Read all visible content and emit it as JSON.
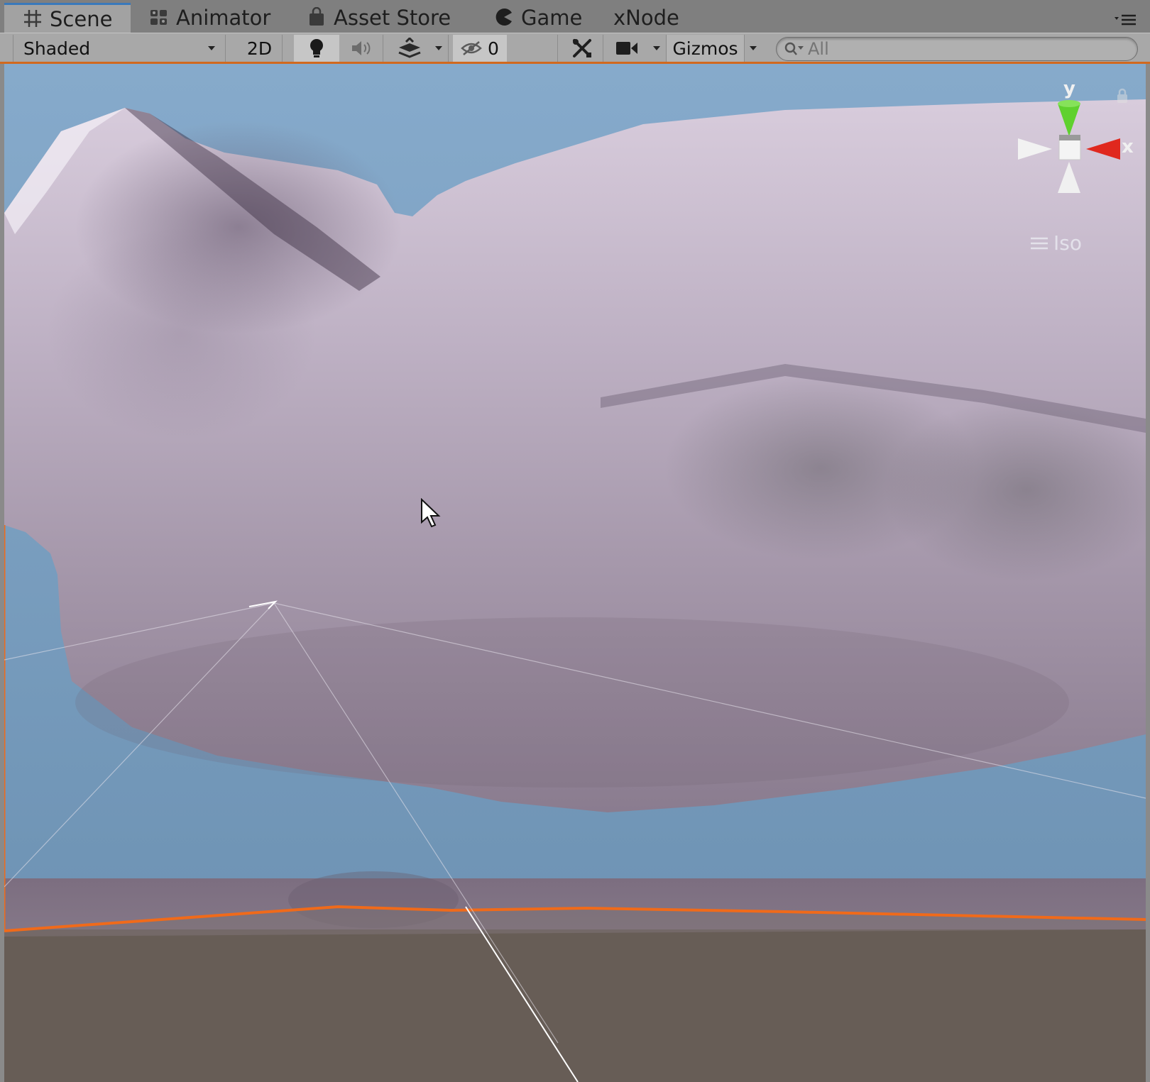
{
  "tabs": [
    {
      "label": "Scene",
      "icon": "grid-icon",
      "active": true
    },
    {
      "label": "Animator",
      "icon": "animator-icon",
      "active": false
    },
    {
      "label": "Asset Store",
      "icon": "shopping-bag-icon",
      "active": false
    },
    {
      "label": "Game",
      "icon": "pacman-icon",
      "active": false
    },
    {
      "label": "xNode",
      "icon": "",
      "active": false
    }
  ],
  "toolbar": {
    "draw_mode": "Shaded",
    "mode_2d": "2D",
    "hidden_count": "0",
    "gizmos": "Gizmos",
    "search_placeholder": "All"
  },
  "scene_gizmo": {
    "y_label": "y",
    "x_label": "x",
    "projection": "Iso",
    "colors": {
      "y": "#5fd12e",
      "x": "#e0281e",
      "neutral": "#f2f2f2"
    }
  },
  "colors": {
    "sky": "#7ea6c6",
    "terrain": "#b6a7bb",
    "ground": "#675d56",
    "selection_outline": "#f06a1a",
    "tab_accent": "#3a79bb"
  }
}
